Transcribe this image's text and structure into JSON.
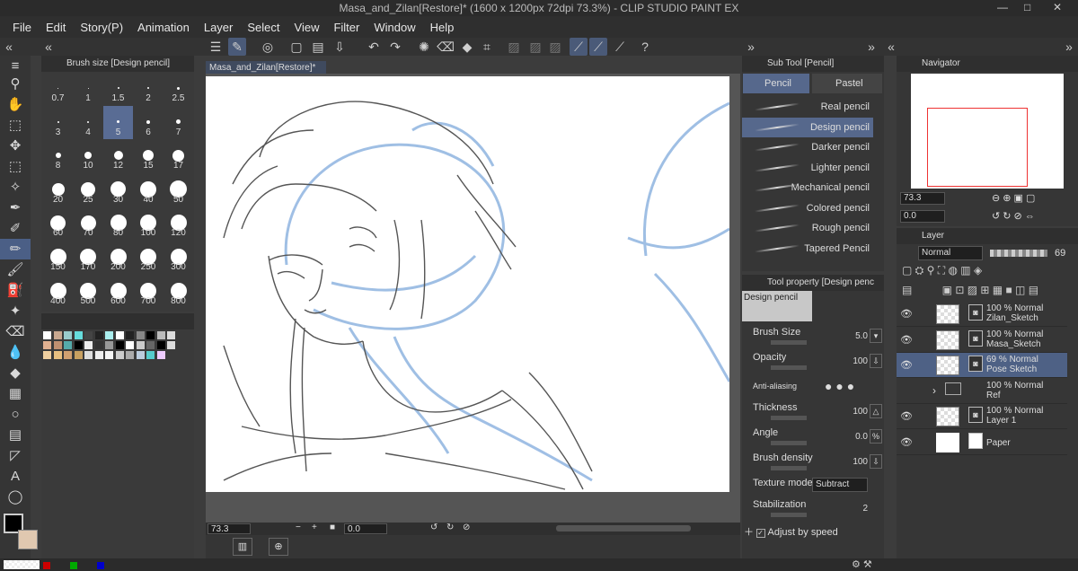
{
  "window": {
    "title": "Masa_and_Zilan[Restore]* (1600 x 1200px 72dpi 73.3%) - CLIP STUDIO PAINT EX"
  },
  "menu": [
    "File",
    "Edit",
    "Story(P)",
    "Animation",
    "Layer",
    "Select",
    "View",
    "Filter",
    "Window",
    "Help"
  ],
  "brush_panel": {
    "title": "Brush size [Design pencil]",
    "sizes": [
      "0.7",
      "1",
      "1.5",
      "2",
      "2.5",
      "3",
      "4",
      "5",
      "6",
      "7",
      "8",
      "10",
      "12",
      "15",
      "17",
      "20",
      "25",
      "30",
      "40",
      "50",
      "60",
      "70",
      "80",
      "100",
      "120",
      "150",
      "170",
      "200",
      "250",
      "300",
      "400",
      "500",
      "600",
      "700",
      "800"
    ],
    "selected": "5"
  },
  "document": {
    "tab": "Masa_and_Zilan[Restore]*"
  },
  "status": {
    "zoom": "73.3",
    "angle": "0.0"
  },
  "sub_tool": {
    "title": "Sub Tool [Pencil]",
    "tabs": [
      "Pencil",
      "Pastel"
    ],
    "items": [
      "Real pencil",
      "Design pencil",
      "Darker pencil",
      "Lighter pencil",
      "Mechanical pencil",
      "Colored pencil",
      "Rough pencil",
      "Tapered Pencil"
    ],
    "selected": "Design pencil"
  },
  "tool_property": {
    "title": "Tool property [Design penc",
    "preset": "Design pencil",
    "brush_size_label": "Brush Size",
    "brush_size": "5.0",
    "opacity_label": "Opacity",
    "opacity": "100",
    "anti_aliasing_label": "Anti-aliasing",
    "thickness_label": "Thickness",
    "thickness": "100",
    "angle_label": "Angle",
    "angle": "0.0",
    "brush_density_label": "Brush density",
    "brush_density": "100",
    "texture_mode_label": "Texture mode",
    "texture_mode": "Subtract",
    "stabilization_label": "Stabilization",
    "stabilization": "2",
    "adjust_label": "Adjust by speed"
  },
  "navigator": {
    "title": "Navigator",
    "zoom": "73.3",
    "angle": "0.0"
  },
  "layer_panel": {
    "title": "Layer",
    "blend_mode": "Normal",
    "opacity": "69",
    "layers": [
      {
        "line1": "100 % Normal",
        "line2": "Zilan_Sketch"
      },
      {
        "line1": "100 % Normal",
        "line2": "Masa_Sketch"
      },
      {
        "line1": "69 % Normal",
        "line2": "Pose Sketch"
      },
      {
        "line1": "100 % Normal",
        "line2": "Ref"
      },
      {
        "line1": "100 % Normal",
        "line2": "Layer 1"
      },
      {
        "line1": "",
        "line2": "Paper"
      }
    ],
    "selected": "Pose Sketch"
  },
  "colors": {
    "main": "#000000",
    "sub": "#e0c8b0",
    "selection": "#56688c"
  }
}
